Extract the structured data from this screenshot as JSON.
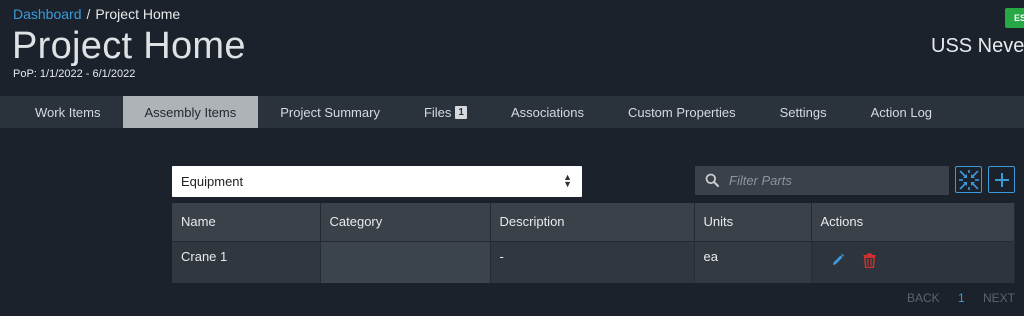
{
  "breadcrumb": {
    "root": "Dashboard",
    "separator": "/",
    "current": "Project Home"
  },
  "page": {
    "title": "Project Home",
    "pop": "PoP: 1/1/2022 - 6/1/2022"
  },
  "header_right": {
    "badge": "ES",
    "ship_name": "USS Neve"
  },
  "tabs": [
    {
      "label": "Work Items"
    },
    {
      "label": "Assembly Items",
      "active": true
    },
    {
      "label": "Project Summary"
    },
    {
      "label": "Files",
      "count": "1"
    },
    {
      "label": "Associations"
    },
    {
      "label": "Custom Properties"
    },
    {
      "label": "Settings"
    },
    {
      "label": "Action Log"
    }
  ],
  "category_select": {
    "value": "Equipment"
  },
  "filter": {
    "placeholder": "Filter Parts",
    "icon": "search-icon"
  },
  "toolbar": {
    "collapse_icon": "collapse-icon",
    "add_icon": "plus-icon"
  },
  "table": {
    "headers": [
      "Name",
      "Category",
      "Description",
      "Units",
      "Actions"
    ],
    "rows": [
      {
        "name": "Crane 1",
        "category": "",
        "description": "-",
        "units": "ea"
      }
    ],
    "row_actions": {
      "edit_icon": "pencil-icon",
      "delete_icon": "trash-icon"
    }
  },
  "pager": {
    "back": "BACK",
    "page": "1",
    "next": "NEXT"
  },
  "colors": {
    "accent": "#3d9ad9",
    "delete": "#d9302f",
    "badge": "#28a745",
    "background": "#1b222b"
  }
}
